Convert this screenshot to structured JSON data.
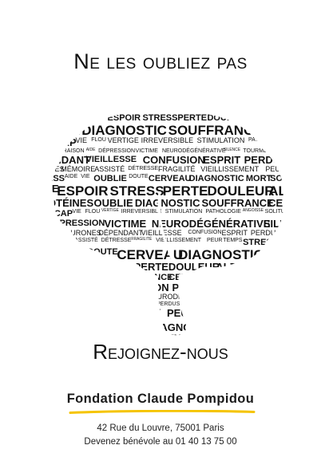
{
  "headline": "Ne les oubliez pas",
  "call_to_action": "Rejoignez-nous",
  "organization": "Fondation Claude Pompidou",
  "address": "42 Rue du Louvre, 75001 Paris",
  "volunteer_line": "Devenez bénévole au 01 40 13 75 00",
  "brain_words": [
    "MORT",
    "SOUVENIR",
    "DOUTE",
    "ESPOIR",
    "STRESS",
    "PERTE",
    "DOULEUR",
    "ALZHEIMER",
    "PROTÉINES",
    "OUBLIE",
    "DIAGNOSTIC",
    "SOUFFRANCE",
    "CERVEAU",
    "HANDICAP",
    "VIE",
    "FLOU",
    "VERTIGE",
    "IRREVERSIBLE",
    "STIMULATION",
    "PATHOLOGIE",
    "ANGOISSE",
    "SOLITUDE",
    "RAISON",
    "AIDE",
    "DÉPRESSION",
    "VICTIME",
    "NEURODÉGÉNÉRATIVE",
    "SILENCE",
    "TOURMENT",
    "NEURONES",
    "DÉPENDANT",
    "VIEILLESSE",
    "CONFUSION",
    "ESPRIT",
    "PERDUS",
    "TROUBLES",
    "SYMPTÔMES",
    "MÉMOIRE",
    "ASSISTÉ",
    "DÉTRESSE",
    "FRAGILITÉ",
    "VIEILLISSEMENT",
    "PEUR",
    "TEMPS",
    "STRESS",
    "AIDE",
    "VIE",
    "OUBLIE",
    "DOUTE",
    "CERVEAU",
    "DIAGNOSTIC"
  ],
  "colors": {
    "text": "#111111",
    "accent_underline": "#f5c400"
  }
}
